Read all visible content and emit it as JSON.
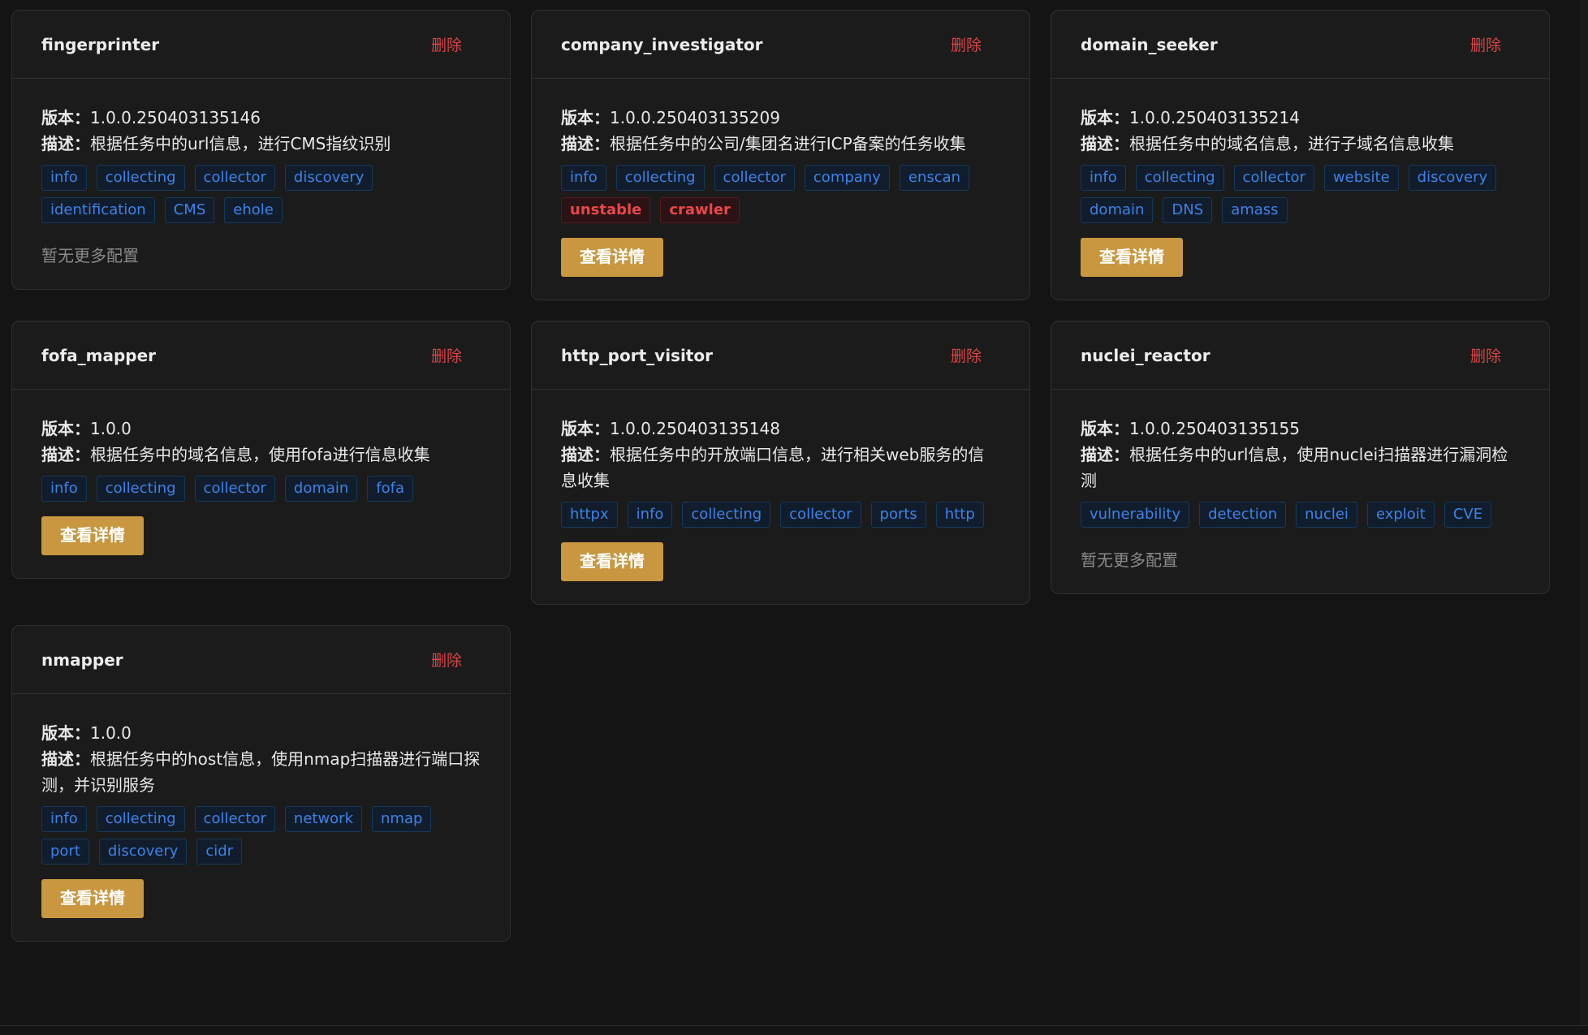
{
  "labels": {
    "delete": "删除",
    "version": "版本：",
    "description": "描述：",
    "details_button": "查看详情",
    "no_more_config": "暂无更多配置"
  },
  "plugins": [
    {
      "name": "fingerprinter",
      "version": "1.0.0.250403135146",
      "description": "根据任务中的url信息，进行CMS指纹识别",
      "tags": [
        {
          "text": "info",
          "style": "blue"
        },
        {
          "text": "collecting",
          "style": "blue"
        },
        {
          "text": "collector",
          "style": "blue"
        },
        {
          "text": "discovery",
          "style": "blue"
        },
        {
          "text": "identification",
          "style": "blue"
        },
        {
          "text": "CMS",
          "style": "blue"
        },
        {
          "text": "ehole",
          "style": "blue"
        }
      ],
      "footer": "none"
    },
    {
      "name": "company_investigator",
      "version": "1.0.0.250403135209",
      "description": "根据任务中的公司/集团名进行ICP备案的任务收集",
      "tags": [
        {
          "text": "info",
          "style": "blue"
        },
        {
          "text": "collecting",
          "style": "blue"
        },
        {
          "text": "collector",
          "style": "blue"
        },
        {
          "text": "company",
          "style": "blue"
        },
        {
          "text": "enscan",
          "style": "blue"
        },
        {
          "text": "unstable",
          "style": "red"
        },
        {
          "text": "crawler",
          "style": "red"
        }
      ],
      "footer": "button"
    },
    {
      "name": "domain_seeker",
      "version": "1.0.0.250403135214",
      "description": "根据任务中的域名信息，进行子域名信息收集",
      "tags": [
        {
          "text": "info",
          "style": "blue"
        },
        {
          "text": "collecting",
          "style": "blue"
        },
        {
          "text": "collector",
          "style": "blue"
        },
        {
          "text": "website",
          "style": "blue"
        },
        {
          "text": "discovery",
          "style": "blue"
        },
        {
          "text": "domain",
          "style": "blue"
        },
        {
          "text": "DNS",
          "style": "blue"
        },
        {
          "text": "amass",
          "style": "blue"
        }
      ],
      "footer": "button"
    },
    {
      "name": "fofa_mapper",
      "version": "1.0.0",
      "description": "根据任务中的域名信息，使用fofa进行信息收集",
      "tags": [
        {
          "text": "info",
          "style": "blue"
        },
        {
          "text": "collecting",
          "style": "blue"
        },
        {
          "text": "collector",
          "style": "blue"
        },
        {
          "text": "domain",
          "style": "blue"
        },
        {
          "text": "fofa",
          "style": "blue"
        }
      ],
      "footer": "button"
    },
    {
      "name": "http_port_visitor",
      "version": "1.0.0.250403135148",
      "description": "根据任务中的开放端口信息，进行相关web服务的信息收集",
      "tags": [
        {
          "text": "httpx",
          "style": "blue"
        },
        {
          "text": "info",
          "style": "blue"
        },
        {
          "text": "collecting",
          "style": "blue"
        },
        {
          "text": "collector",
          "style": "blue"
        },
        {
          "text": "ports",
          "style": "blue"
        },
        {
          "text": "http",
          "style": "blue"
        }
      ],
      "footer": "button"
    },
    {
      "name": "nuclei_reactor",
      "version": "1.0.0.250403135155",
      "description": "根据任务中的url信息，使用nuclei扫描器进行漏洞检测",
      "tags": [
        {
          "text": "vulnerability",
          "style": "blue"
        },
        {
          "text": "detection",
          "style": "blue"
        },
        {
          "text": "nuclei",
          "style": "blue"
        },
        {
          "text": "exploit",
          "style": "blue"
        },
        {
          "text": "CVE",
          "style": "blue"
        }
      ],
      "footer": "none"
    },
    {
      "name": "nmapper",
      "version": "1.0.0",
      "description": "根据任务中的host信息，使用nmap扫描器进行端口探测，并识别服务",
      "tags": [
        {
          "text": "info",
          "style": "blue"
        },
        {
          "text": "collecting",
          "style": "blue"
        },
        {
          "text": "collector",
          "style": "blue"
        },
        {
          "text": "network",
          "style": "blue"
        },
        {
          "text": "nmap",
          "style": "blue"
        },
        {
          "text": "port",
          "style": "blue"
        },
        {
          "text": "discovery",
          "style": "blue"
        },
        {
          "text": "cidr",
          "style": "blue"
        }
      ],
      "footer": "button"
    }
  ],
  "colors": {
    "background": "#141414",
    "card": "#1b1b1b",
    "delete_red": "#dc4446",
    "tag_blue": "#3e82e8",
    "button_gold": "#c8973f"
  }
}
